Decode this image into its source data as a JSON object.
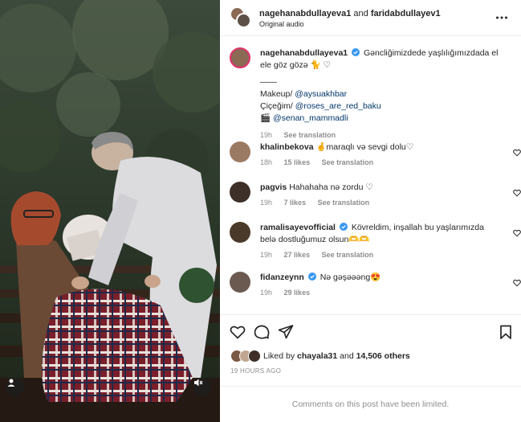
{
  "header": {
    "user1": "nagehanabdullayeva1",
    "and": "and",
    "user2": "faridabdullayev1",
    "audio": "Original audio"
  },
  "caption": {
    "user": "nagehanabdullayeva1",
    "text": "Gəncliğimizdede yaşlılığımızdada el ele göz gözə 🐈 ♡",
    "line_sep": "——",
    "makeup_label": "Makeup/",
    "makeup_handle": "@aysuakhbar",
    "flower_label": "Çiçeğim/",
    "flower_handle": "@roses_are_red_baku",
    "camera_icon_text": "🎬",
    "video_handle": "@senan_mammadli",
    "time": "19h",
    "translation": "See translation"
  },
  "comments": [
    {
      "user": "khalinbekova",
      "text": "🤞maraqlı və sevgi dolu♡",
      "time": "18h",
      "likes": "15 likes",
      "translation": "See translation",
      "verified": false
    },
    {
      "user": "pagvis",
      "text": "Hahahaha nə zordu ♡",
      "time": "19h",
      "likes": "7 likes",
      "translation": "See translation",
      "verified": false
    },
    {
      "user": "ramalisayevofficial",
      "text": "Kövreldim, inşallah bu yaşlarımızda belə dostluğumuz olsun🫶🫶",
      "time": "19h",
      "likes": "27 likes",
      "translation": "See translation",
      "verified": true
    },
    {
      "user": "fidanzeynn",
      "text": "Nə gəşəəəng😍",
      "time": "19h",
      "likes": "29 likes",
      "translation": "",
      "verified": true
    }
  ],
  "likes": {
    "prefix": "Liked by",
    "user": "chayala31",
    "and": "and",
    "count": "14,506 others"
  },
  "time_ago": "19 HOURS AGO",
  "limited_notice": "Comments on this post have been limited.",
  "icons": {
    "more": "more-icon",
    "heart": "heart-icon",
    "comment": "comment-icon",
    "share": "share-icon",
    "save": "bookmark-icon",
    "mute": "mute-icon",
    "user_tag": "user-tag-icon"
  },
  "colors": {
    "verified": "#3897f0",
    "mention": "#00376b",
    "muted": "#8e8e8e"
  }
}
